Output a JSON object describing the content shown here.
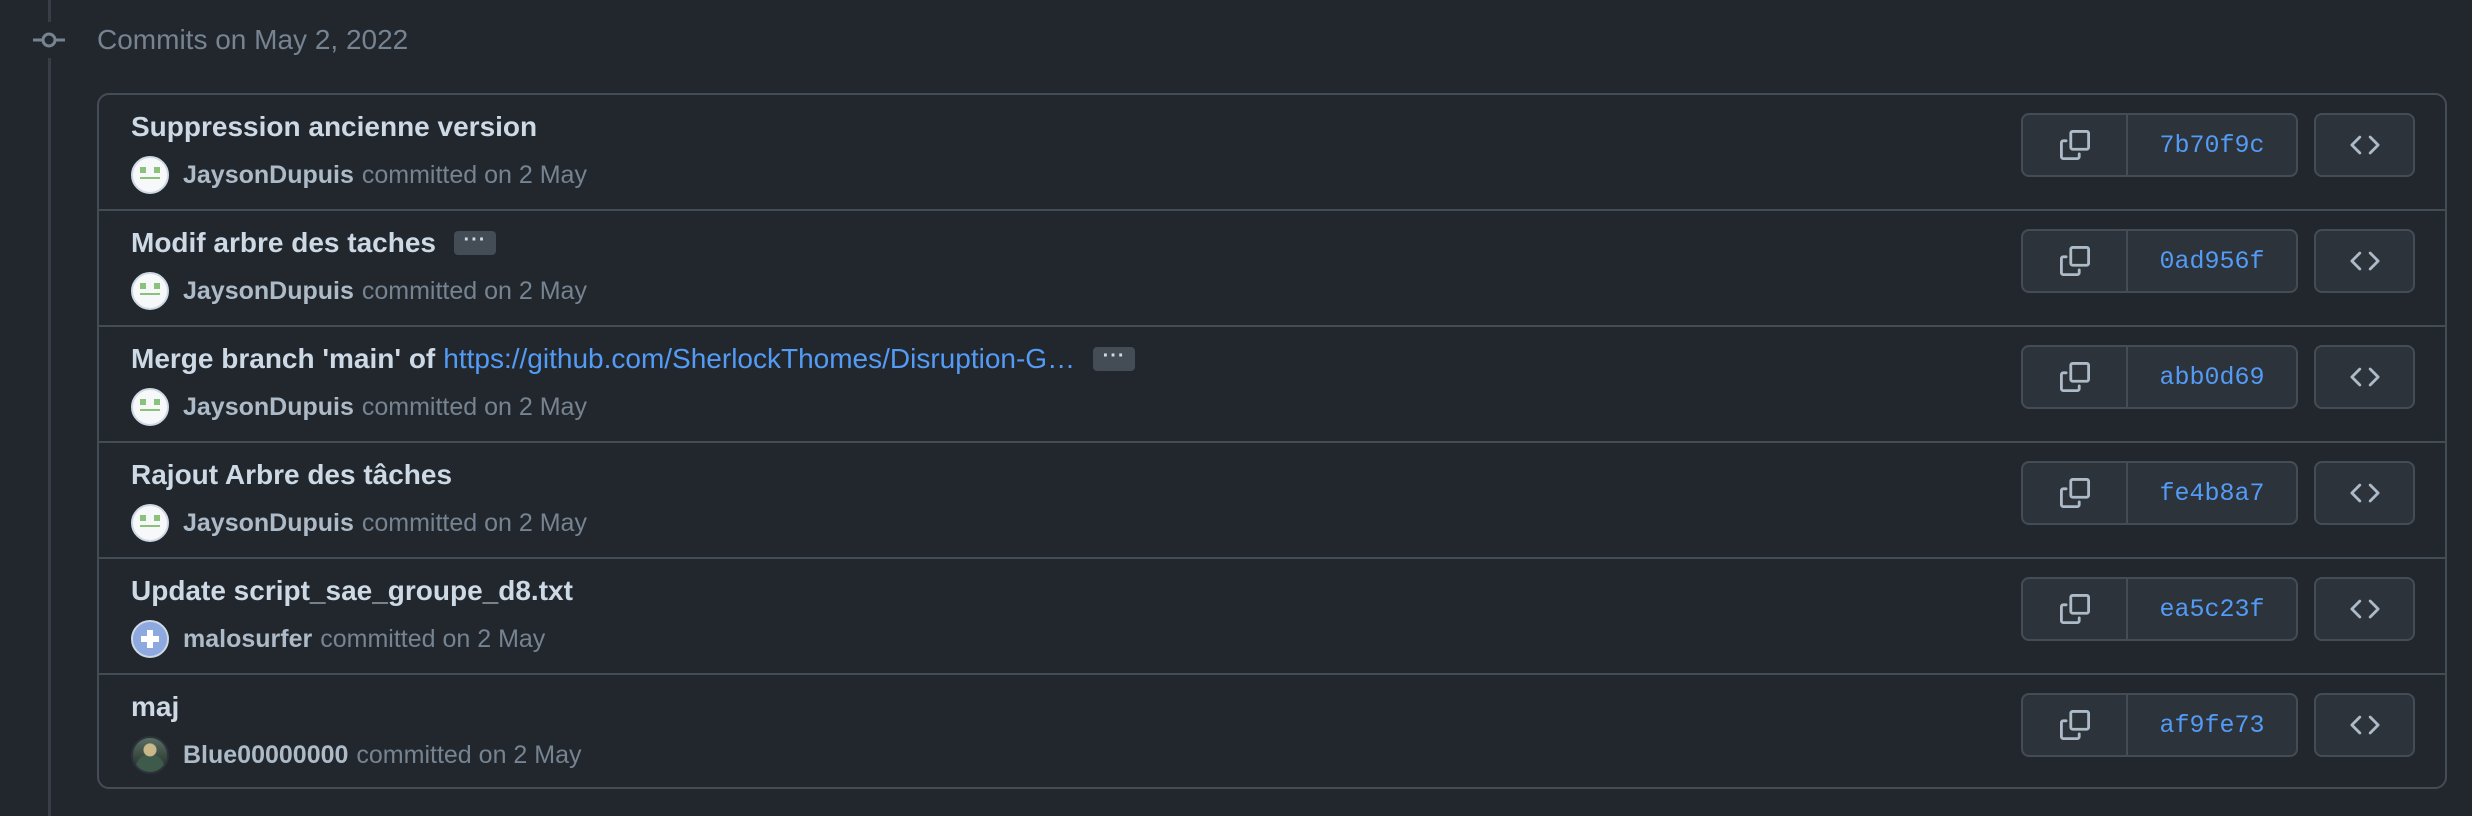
{
  "header": {
    "title": "Commits on May 2, 2022"
  },
  "icons": {
    "timeline": "git-commit-icon",
    "copy": "copy-icon",
    "browse": "code-icon",
    "more": "ellipsis-icon"
  },
  "colors": {
    "background": "#22272e",
    "border": "#444c56",
    "link": "#539bf5",
    "title": "#cdd9e5",
    "muted": "#768390"
  },
  "commits": [
    {
      "title": "Suppression ancienne version",
      "link": "",
      "has_more": false,
      "author": "JaysonDupuis",
      "avatar": "green",
      "meta": "committed on 2 May",
      "sha": "7b70f9c"
    },
    {
      "title": "Modif arbre des taches",
      "link": "",
      "has_more": true,
      "author": "JaysonDupuis",
      "avatar": "green",
      "meta": "committed on 2 May",
      "sha": "0ad956f"
    },
    {
      "title": "Merge branch 'main' of",
      "link": "https://github.com/SherlockThomes/Disruption-G…",
      "has_more": true,
      "author": "JaysonDupuis",
      "avatar": "green",
      "meta": "committed on 2 May",
      "sha": "abb0d69"
    },
    {
      "title": "Rajout Arbre des tâches",
      "link": "",
      "has_more": false,
      "author": "JaysonDupuis",
      "avatar": "green",
      "meta": "committed on 2 May",
      "sha": "fe4b8a7"
    },
    {
      "title": "Update script_sae_groupe_d8.txt",
      "link": "",
      "has_more": false,
      "author": "malosurfer",
      "avatar": "blue",
      "meta": "committed on 2 May",
      "sha": "ea5c23f"
    },
    {
      "title": "maj",
      "link": "",
      "has_more": false,
      "author": "Blue00000000",
      "avatar": "photo",
      "meta": "committed on 2 May",
      "sha": "af9fe73"
    }
  ]
}
